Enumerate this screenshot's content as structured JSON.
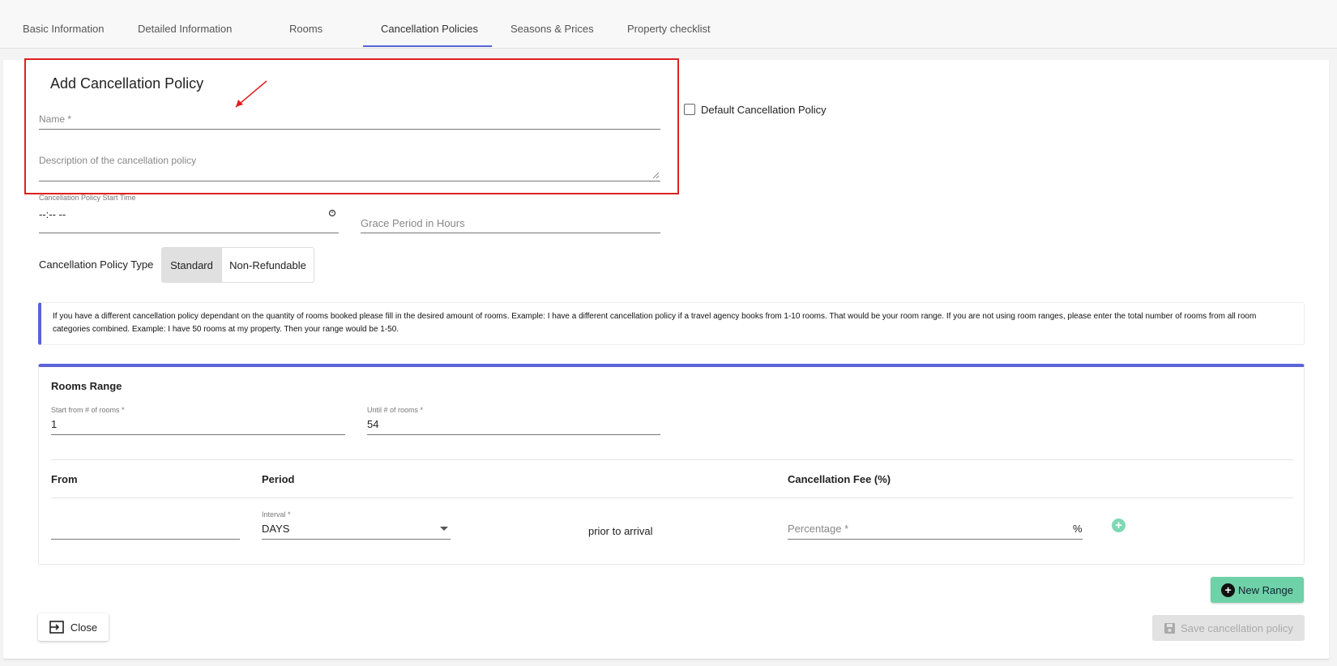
{
  "tabs": [
    "Basic Information",
    "Detailed Information",
    "Rooms",
    "Cancellation Policies",
    "Seasons & Prices",
    "Property checklist"
  ],
  "form": {
    "title": "Add Cancellation Policy",
    "name_label": "Name *",
    "description_label": "Description of the cancellation policy",
    "default_checkbox_label": "Default Cancellation Policy",
    "start_time_label": "Cancellation Policy Start Time",
    "start_time_value": "--:-- --",
    "grace_label": "Grace Period in Hours",
    "type_label": "Cancellation Policy Type",
    "type_options": [
      "Standard",
      "Non-Refundable"
    ],
    "type_selected": "Standard"
  },
  "info_text": "If you have a different cancellation policy dependant on the quantity of rooms booked please fill in the desired amount of rooms. Example: I have a different cancellation policy if a travel agency books from 1-10 rooms. That would be your room range. If you are not using room ranges, please enter the total number of rooms from all room categories combined. Example: I have 50 rooms at my property. Then your range would be 1-50.",
  "rooms_range": {
    "title": "Rooms Range",
    "start_label": "Start from # of rooms *",
    "start_value": "1",
    "until_label": "Until # of rooms *",
    "until_value": "54",
    "columns": [
      "From",
      "Period",
      "Cancellation Fee (%)"
    ],
    "interval_label": "Interval *",
    "interval_value": "DAYS",
    "prior_text": "prior to arrival",
    "percentage_label": "Percentage *",
    "percent_sign": "%"
  },
  "buttons": {
    "new_range": "New Range",
    "close": "Close",
    "save": "Save cancellation policy"
  },
  "colors": {
    "accent": "#5a63d9",
    "highlight": "#e02020",
    "green": "#6fd1a7"
  }
}
